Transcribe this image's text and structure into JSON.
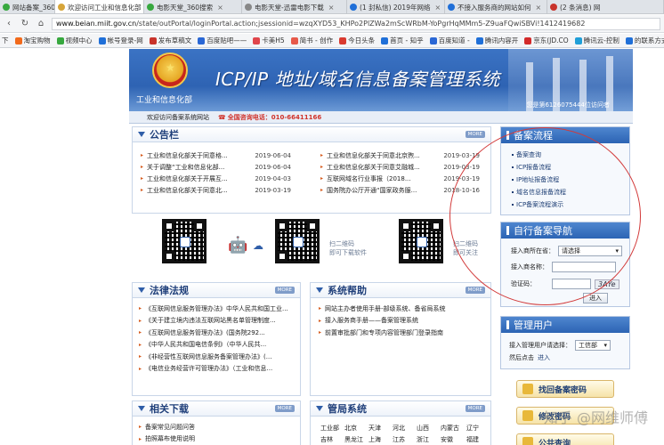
{
  "tabs": [
    {
      "label": "网站备案_360搜索",
      "color": "#37a83f",
      "active": false
    },
    {
      "label": "欢迎访问工业和信息化部",
      "color": "#d7a53a",
      "active": true
    },
    {
      "label": "电影天堂_360搜索",
      "color": "#37a83f",
      "active": false
    },
    {
      "label": "电影天堂-迅雷电影下载",
      "color": "#888888",
      "active": false
    },
    {
      "label": "(1 封私信) 2019年网络",
      "color": "#1f6fd8",
      "active": false
    },
    {
      "label": "不接入服务商的网站如何",
      "color": "#1f6fd8",
      "active": false
    },
    {
      "label": "(2 条消息) 网",
      "color": "#c8332b",
      "active": false
    }
  ],
  "address": {
    "host": "www.beian.miit.gov.cn",
    "path": "/state/outPortal/loginPortal.action;jsessionid=wzqXYD53_KHPo2PlZWa2mScWRbM-YoPgrHqMMm5-Z9uaFQwiSBVi!1412419682"
  },
  "bookmarks": [
    {
      "label": "下",
      "color": "#777777"
    },
    {
      "label": "淘宝购物",
      "color": "#f26a1b"
    },
    {
      "label": "视频中心",
      "color": "#37a83f"
    },
    {
      "label": "帐号登录-网",
      "color": "#1f6fd8"
    },
    {
      "label": "发布草稿文",
      "color": "#c8332b"
    },
    {
      "label": "百度贴吧——",
      "color": "#2a67d5"
    },
    {
      "label": "卡美H5",
      "color": "#e0454b"
    },
    {
      "label": "简书 - 创作",
      "color": "#e7594a"
    },
    {
      "label": "今日头条",
      "color": "#d93a2f"
    },
    {
      "label": "首页 - 知乎",
      "color": "#1f6fd8"
    },
    {
      "label": "百度知道 -",
      "color": "#2a67d5"
    },
    {
      "label": "腾讯内容开",
      "color": "#1f6fd8"
    },
    {
      "label": "京东(JD.CO",
      "color": "#d32a2a"
    },
    {
      "label": "腾讯云-控制",
      "color": "#1f9fd8"
    },
    {
      "label": "的联系方式",
      "color": "#1f6fd8"
    }
  ],
  "banner": {
    "title": "ICP/IP 地址/域名信息备案管理系统",
    "ministry": "工业和信息化部",
    "ip_text": "您是第6126075444位访问者"
  },
  "infobar": {
    "welcome": "欢迎访问备案系统网站",
    "phone": "全国咨询电话：010-66411166"
  },
  "announcement": {
    "title": "公告栏",
    "more": "MORE",
    "left": [
      {
        "title": "工业和信息化部关于同意格...",
        "date": "2019-06-04"
      },
      {
        "title": "关于调整“工业和信息化部...",
        "date": "2019-06-04"
      },
      {
        "title": "工业和信息化部关于开展互...",
        "date": "2019-04-03"
      },
      {
        "title": "工业和信息化部关于同意北...",
        "date": "2019-03-19"
      }
    ],
    "right": [
      {
        "title": "工业和信息化部关于同意北京煦...",
        "date": "2019-03-19"
      },
      {
        "title": "工业和信息化部关于同意艾融城...",
        "date": "2019-03-19"
      },
      {
        "title": "互联网域名行业事报（2018...",
        "date": "2019-03-19"
      },
      {
        "title": "国务院办公厅开通“国家政务服...",
        "date": "2018-10-16"
      }
    ]
  },
  "apps": {
    "scan1": "扫二维码",
    "dl1": "即可下载软件",
    "scan2": "扫二维码",
    "dl2": "即可关注"
  },
  "laws": {
    "title": "法律法规",
    "more": "MORE",
    "items": [
      "《互联网信息服务管理办法》中华人民共和国工业...",
      "《关于建立境内违法互联网站黑名单管理制度...",
      "《互联网信息服务管理办法》(国务院292...",
      "《中华人民共和国电信条例》（中华人民共...",
      "《非经营性互联网信息服务备案管理办法》(...",
      "《电信业务经营许可管理办法》（工业和信息..."
    ]
  },
  "help": {
    "title": "系统帮助",
    "more": "MORE",
    "items": [
      "网站主办者使用手册-部级系统、备省局系统",
      "接入服务商手册——备案管理系统",
      "前置审批部门和专项内容管理部门登录指南"
    ]
  },
  "downloads": {
    "title": "相关下载",
    "more": "MORE",
    "items": [
      "备案常见问题问答",
      "拍照幕布使用说明"
    ]
  },
  "bureaus": {
    "title": "管局系统",
    "more": "MORE",
    "row1": [
      "工业部",
      "北京",
      "天津",
      "河北",
      "山西",
      "内蒙古",
      "辽宁"
    ],
    "row2": [
      "吉林",
      "黑龙江",
      "上海",
      "江苏",
      "浙江",
      "安徽",
      "福建"
    ]
  },
  "flow": {
    "title": "备案流程",
    "items": [
      "备案查询",
      "ICP报备流程",
      "IP地址报备流程",
      "域名信息报备流程",
      "ICP备案流程演示"
    ]
  },
  "navbox": {
    "title": "自行备案导航",
    "label_bureau": "接入商所在省：",
    "bureau_value": "请选择",
    "label_name": "接入商名称：",
    "label_code": "验证码：",
    "captcha": "3AYe",
    "submit": "进入"
  },
  "userbox": {
    "title": "管理用户",
    "label": "接入管理用户请选择：",
    "value": "工信部",
    "hint": "然后点击",
    "enter": "进入"
  },
  "buttons": {
    "find_password": "找回备案密码",
    "modify": "修改密码",
    "last": "公共查询"
  },
  "watermark": "知乎 @网维师傅"
}
